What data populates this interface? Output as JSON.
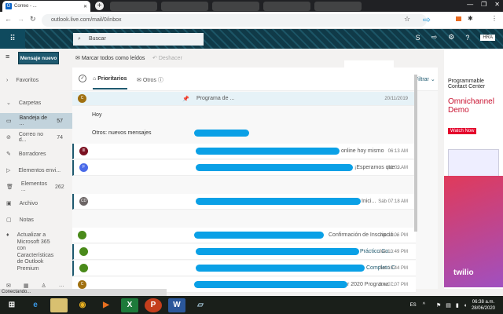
{
  "browser": {
    "tab_title": "Correo - ...",
    "url": "outlook.live.com/mail/0/inbox"
  },
  "header": {
    "search_placeholder": "Buscar",
    "user_badge": "HRA"
  },
  "toolbar": {
    "new_message": "Mensaje nuevo",
    "mark_all_read": "Marcar todos como leídos",
    "undo": "Deshacer"
  },
  "sidebar": {
    "favorites": "Favoritos",
    "folders": "Carpetas",
    "items": [
      {
        "label": "Bandeja de ...",
        "count": "57"
      },
      {
        "label": "Correo no d...",
        "count": "74"
      },
      {
        "label": "Borradores",
        "count": ""
      },
      {
        "label": "Elementos envi...",
        "count": ""
      },
      {
        "label": "Elementos ...",
        "count": "262"
      },
      {
        "label": "Archivo",
        "count": ""
      },
      {
        "label": "Notas",
        "count": ""
      }
    ],
    "upgrade": "Actualizar a Microsoft 365 con Características de Outlook Premium"
  },
  "list": {
    "tabs": {
      "focused": "Prioritarios",
      "other": "Otros"
    },
    "filter": "Filtrar",
    "pinned": {
      "avatar": "C",
      "preview": "Programa de ...",
      "time": "20/11/2019"
    },
    "today": "Hoy",
    "other_new": "Otros: nuevos mensajes",
    "rows": [
      {
        "avatar": "III",
        "color": "#7a1020",
        "preview": "online hoy mismo",
        "time": "06:13 AM"
      },
      {
        "avatar": "F",
        "color": "#4a6ae8",
        "preview": "¡Esperamos que ...",
        "time": "01:09 AM"
      },
      {
        "avatar": "CD",
        "color": "#6b6464",
        "preview": "Inici...",
        "time": "Sáb 07:18 AM"
      },
      {
        "avatar": "",
        "color": "#4a8a1a",
        "preview": "Confirmación de Inscripció...",
        "time": "Jue 11:06 PM"
      },
      {
        "avatar": "",
        "color": "#4a8a1a",
        "preview": "Práctico   Co...",
        "time": "Jue 10:49 PM"
      },
      {
        "avatar": "",
        "color": "#4a8a1a",
        "preview": "Completo   C",
        "time": "Jue 10:44 PM"
      },
      {
        "avatar": "C",
        "color": "#a07010",
        "preview": "r 2020   Programa ...",
        "time": "Jue 07:07 PM"
      }
    ]
  },
  "ad": {
    "line1": "Programmable Contact Center",
    "line2": "Omnichannel Demo",
    "cta": "Watch Now",
    "brand": "twilio"
  },
  "status": "Conectando...",
  "taskbar": {
    "lang": "ES",
    "time": "06:38 a.m.",
    "date": "28/06/2020"
  }
}
